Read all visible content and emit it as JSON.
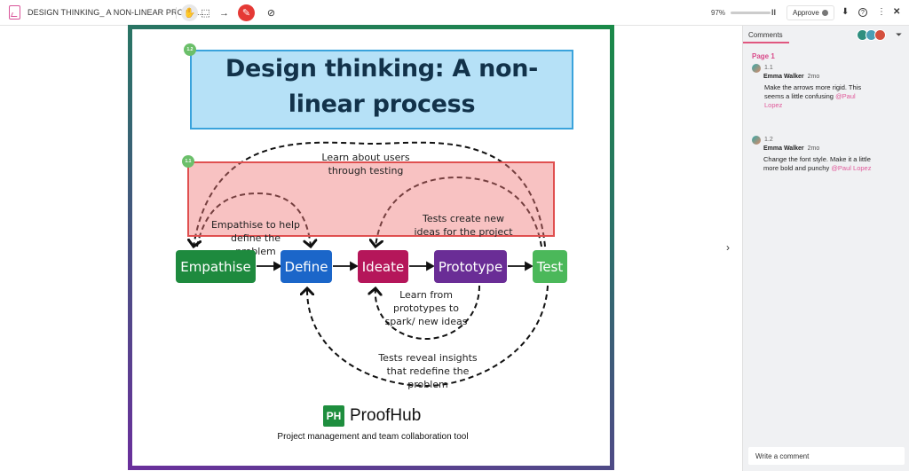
{
  "toolbar": {
    "doc_title": "DESIGN THINKING_ A NON-LINEAR PROCE......",
    "tools": [
      {
        "name": "pan-tool",
        "glyph": "✋"
      },
      {
        "name": "area-select-tool",
        "glyph": "⬚"
      },
      {
        "name": "arrow-tool",
        "glyph": "→"
      },
      {
        "name": "draw-tool",
        "glyph": "✎"
      },
      {
        "name": "hide-comments-tool",
        "glyph": "⊘"
      }
    ],
    "zoom_pct": "97%",
    "zoom_handle": "II",
    "approve_label": "Approve",
    "download_glyph": "⬇",
    "help_glyph": "?",
    "more_glyph": "⋮",
    "close_glyph": "✕"
  },
  "canvas": {
    "title": "Design thinking: A non-linear process",
    "pin_title": "1.2",
    "pin_red": "1.1",
    "labels": {
      "learn_users": "Learn about users through testing",
      "empathise_help": "Empathise to help define the problem",
      "tests_create": "Tests create new ideas for the project",
      "learn_prototypes": "Learn from prototypes to spark/ new ideas",
      "tests_reveal": "Tests reveal insights that redefine the problem"
    },
    "steps": [
      {
        "label": "Empathise",
        "color": "#1e8a3e"
      },
      {
        "label": "Define",
        "color": "#1b66c9"
      },
      {
        "label": "Ideate",
        "color": "#b5165a"
      },
      {
        "label": "Prototype",
        "color": "#6a2d96"
      },
      {
        "label": "Test",
        "color": "#4bb85a"
      }
    ],
    "logo_mark": "PH",
    "logo_name": "ProofHub",
    "tagline": "Project management and team collaboration tool"
  },
  "expand_glyph": "›",
  "comments_panel": {
    "tab_label": "Comments",
    "filter_glyph": "⏷",
    "page_label": "Page 1",
    "comments": [
      {
        "num": "1.1",
        "author": "Emma Walker",
        "time": "2mo",
        "text": "Make the arrows more rigid. This seems a little confusing",
        "mention": "@Paul Lopez"
      },
      {
        "num": "1.2",
        "author": "Emma Walker",
        "time": "2mo",
        "text": "Change the font style. Make it a little more bold and punchy",
        "mention": "@Paul Lopez"
      }
    ],
    "input_placeholder": "Write a comment"
  },
  "colors": {
    "accent_pink": "#e0577f",
    "title_box_fill": "#b6e1f7",
    "red_box_fill": "#f5b8b8"
  }
}
